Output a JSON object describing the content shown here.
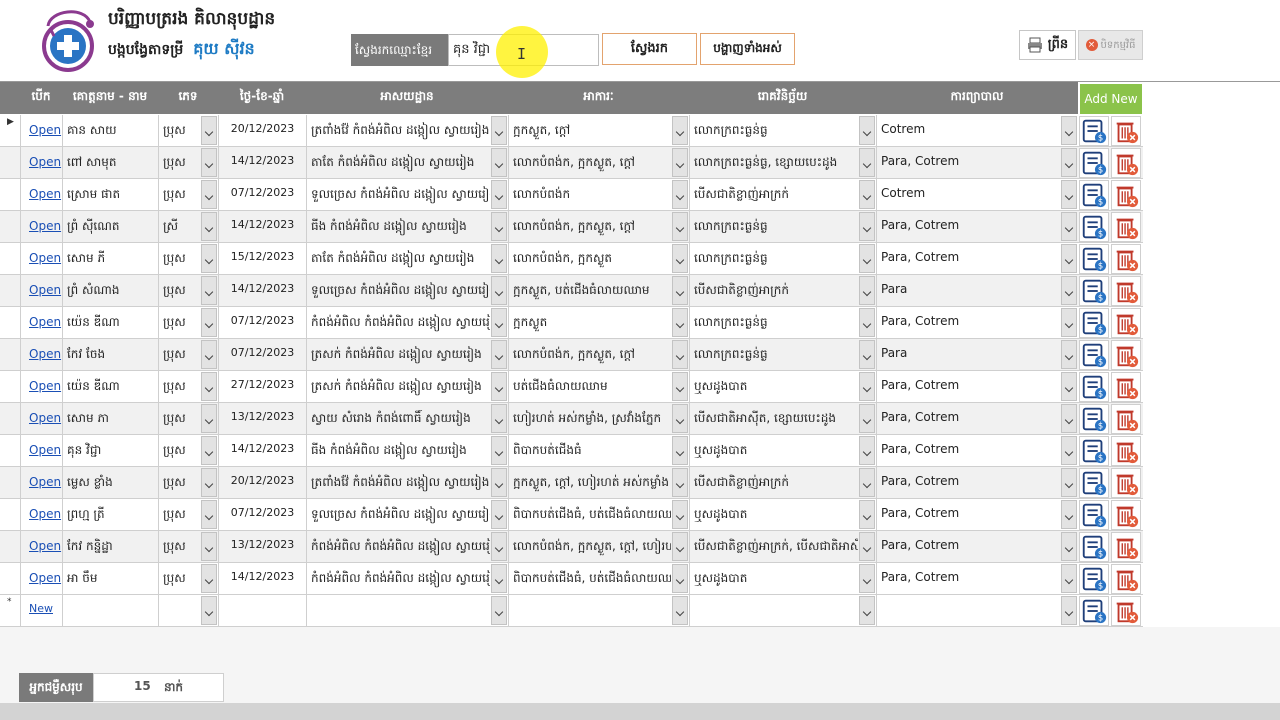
{
  "header": {
    "title_line1": "បរិញ្ញាបត្ររង គិលានុបដ្ឋាន",
    "title_line2": "បង្កបង្វែតាទម្រី",
    "title_brand": "គុយ ស៊ីវន"
  },
  "search": {
    "label": "ស្វែងរកឈ្មោះខ្មែរ",
    "value": "គុន វិជ្ជា",
    "search_button": "ស្វែងរក",
    "show_all_button": "បង្ហាញទាំងអស់"
  },
  "toolbar": {
    "print_label": "ព្រីន",
    "close_label": "បិទកម្មវិធី"
  },
  "grid": {
    "columns": [
      "បើក",
      "គោត្តនាម - នាម",
      "ភេទ",
      "ថ្ងៃ-ខែ-ឆ្នាំ",
      "អាសយដ្ឋាន",
      "អាការៈ",
      "រោគវិនិច្ឆ័យ",
      "ការព្យាបាល"
    ],
    "add_new_label": "Add New",
    "open_label": "Open",
    "new_label": "New",
    "rows": [
      {
        "name": "គាន សាយ",
        "sex": "ប្រុស",
        "date": "20/12/2023",
        "address": "ត្រពាំងវ៉ែ កំពង់អំពិល ដង្កៀល ស្វាយរៀង",
        "symptom": "ក្អកស្ងួត, ក្តៅ",
        "diagnosis": "លោកក្រពះធ្ងន់ធ្ង",
        "treatment": "Cotrem"
      },
      {
        "name": "ពៅ សាមុត",
        "sex": "ប្រុស",
        "date": "14/12/2023",
        "address": "តាតែ កំពង់អំពិល ដង្កៀល ស្វាយរៀង",
        "symptom": "លោកបំពង់ក, ក្អកស្ងួត, ក្តៅ",
        "diagnosis": "លោកក្រពះធ្ងន់ធ្ង, ខ្សោយបេះដូង",
        "treatment": "Para, Cotrem"
      },
      {
        "name": "ស្រោម ផាត",
        "sex": "ប្រុស",
        "date": "07/12/2023",
        "address": "ទួលច្រេស កំពង់អំពិល ដង្កៀល ស្វាយរៀង",
        "symptom": "លោកបំពង់ក",
        "diagnosis": "បើសជាតិខ្លាញ់អាក្រក់",
        "treatment": "Cotrem"
      },
      {
        "name": "ព្រំ ស៊ីណេត",
        "sex": "ស្រី",
        "date": "14/12/2023",
        "address": "ធីង កំពង់អំពិល ដង្កៀល ស្វាយរៀង",
        "symptom": "លោកបំពង់ក, ក្អកស្ងួត, ក្តៅ",
        "diagnosis": "លោកក្រពះធ្ងន់ធ្ង",
        "treatment": "Para, Cotrem"
      },
      {
        "name": "សោម ភី",
        "sex": "ប្រុស",
        "date": "15/12/2023",
        "address": "តាតែ កំពង់អំពិល ដង្កៀល ស្វាយរៀង",
        "symptom": "លោកបំពង់ក, ក្អកស្ងួត",
        "diagnosis": "លោកក្រពះធ្ងន់ធ្ង",
        "treatment": "Para, Cotrem"
      },
      {
        "name": "ព្រំ សំណាង",
        "sex": "ប្រុស",
        "date": "14/12/2023",
        "address": "ទួលច្រេស កំពង់អំពិល ដង្កៀល ស្វាយរៀង",
        "symptom": "ក្អកស្ងួត, បត់ជើងធំលាយឈាម",
        "diagnosis": "បើសជាតិខ្លាញ់អាក្រក់",
        "treatment": "Para"
      },
      {
        "name": "យ៉េន ឌីណា",
        "sex": "ប្រុស",
        "date": "07/12/2023",
        "address": "កំពង់អំពិល កំពង់អំពិល ដង្កៀល ស្វាយរៀង",
        "symptom": "ក្អកស្ងួត",
        "diagnosis": "លោកក្រពះធ្ងន់ធ្ង",
        "treatment": "Para, Cotrem"
      },
      {
        "name": "កែវ ចែង",
        "sex": "ប្រុស",
        "date": "07/12/2023",
        "address": "ត្រសក់ កំពង់អំពិល ដង្កៀល ស្វាយរៀង",
        "symptom": "លោកបំពង់ក, ក្អកស្ងួត, ក្តៅ",
        "diagnosis": "លោកក្រពះធ្ងន់ធ្ង",
        "treatment": "Para"
      },
      {
        "name": "យ៉េន ឌីណា",
        "sex": "ប្រុស",
        "date": "27/12/2023",
        "address": "ត្រសក់ កំពង់អំពិល ដង្កៀល ស្វាយរៀង",
        "symptom": "បត់ជើងធំលាយឈាម",
        "diagnosis": "ឬសដូងបាត",
        "treatment": "Para, Cotrem"
      },
      {
        "name": "សោម ភា",
        "sex": "ប្រុស",
        "date": "13/12/2023",
        "address": "ស្វាយ សំរោង កំពង់ពោធិ៍ ស្វាយរៀង",
        "symptom": "ហៀរហត់ អស់កម្លាំង, ស្រវាំងភ្នែក",
        "diagnosis": "បើសជាតិអាស៊ីត, ខ្សោយបេះដូង",
        "treatment": "Para, Cotrem"
      },
      {
        "name": "គុន វិជ្ជា",
        "sex": "ប្រុស",
        "date": "14/12/2023",
        "address": "ធីង កំពង់អំពិល ដង្កៀល ស្វាយរៀង",
        "symptom": "ពិបាកបត់ជើងធំ",
        "diagnosis": "ឬសដូងបាត",
        "treatment": "Para, Cotrem"
      },
      {
        "name": "ម្លេស ខ្លាំង",
        "sex": "ប្រុស",
        "date": "20/12/2023",
        "address": "ត្រពាំងវ៉ែ កំពង់អំពិល ដង្កៀល ស្វាយរៀង",
        "symptom": "ក្អកស្ងួត, ក្តៅ, ហៀរហត់ អស់កម្លាំង",
        "diagnosis": "បើសជាតិខ្លាញ់អាក្រក់",
        "treatment": "Para, Cotrem"
      },
      {
        "name": "ព្រហ្ម ត្រី",
        "sex": "ប្រុស",
        "date": "07/12/2023",
        "address": "ទួលច្រេស កំពង់អំពិល ដង្កៀល ស្វាយរៀង",
        "symptom": "ពិបាកបត់ជើងធំ, បត់ជើងធំលាយឈាម",
        "diagnosis": "ឬសដូងបាត",
        "treatment": "Para, Cotrem"
      },
      {
        "name": "កែវ កន្និដ្ឋា",
        "sex": "ប្រុស",
        "date": "13/12/2023",
        "address": "កំពង់អំពិល កំពង់អំពិល ដង្កៀល ស្វាយរៀង",
        "symptom": "លោកបំពង់ក, ក្អកស្ងួត, ក្តៅ, ហៀរហត់",
        "diagnosis": "បើសជាតិខ្លាញ់អាក្រក់, បើសជាតិអាស៊ីត",
        "treatment": "Para, Cotrem"
      },
      {
        "name": "អា ចឹម",
        "sex": "ប្រុស",
        "date": "14/12/2023",
        "address": "កំពង់អំពិល កំពង់អំពិល ដង្កៀល ស្វាយរៀង",
        "symptom": "ពិបាកបត់ជើងធំ, បត់ជើងធំលាយឈាម",
        "diagnosis": "ឬសដូងបាត",
        "treatment": "Para, Cotrem"
      }
    ]
  },
  "footer": {
    "total_label": "អ្នកជម្ងឺសរុប",
    "total_count": "15",
    "total_unit": "នាក់"
  },
  "colors": {
    "header_gray": "#7d7d7d",
    "add_new_green": "#8bc34a",
    "link_blue": "#1a4fb5",
    "accent_orange": "#e3a36e",
    "highlight_yellow": "#fff000"
  }
}
